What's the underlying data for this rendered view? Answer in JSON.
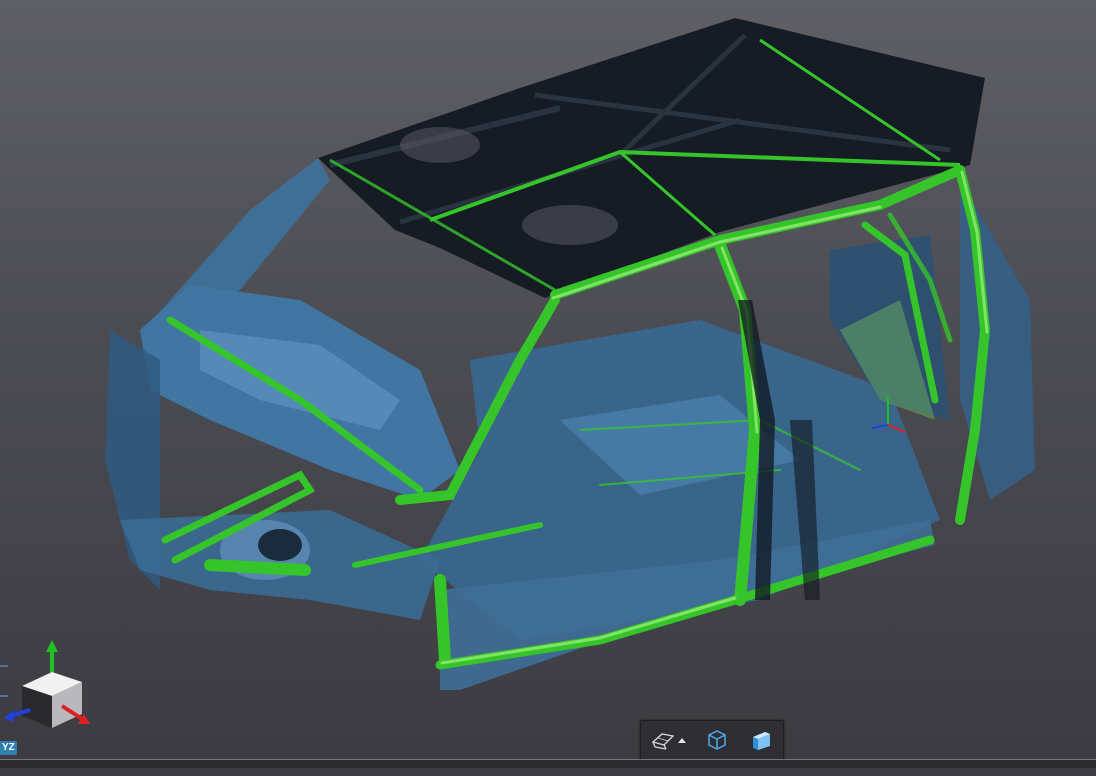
{
  "viewport": {
    "background_top": "#5f5f66",
    "background_bottom": "#3b3b41",
    "model_colors": {
      "scan": "#3f6e96",
      "scan_highlight": "#6f9cc4",
      "roof": "#141a22",
      "cage": "#35c42a",
      "cage_light": "#78e05a"
    }
  },
  "toolbar": {
    "buttons": [
      {
        "icon": "perspective-view-icon",
        "has_dropdown": true
      },
      {
        "icon": "bounding-box-cube-icon",
        "has_dropdown": false
      },
      {
        "icon": "shaded-solid-icon",
        "has_dropdown": false
      }
    ]
  },
  "orientation": {
    "axis_label": "YZ",
    "x_axis_color": "#e02020",
    "y_axis_color": "#20c020",
    "z_axis_color": "#2040e0"
  }
}
